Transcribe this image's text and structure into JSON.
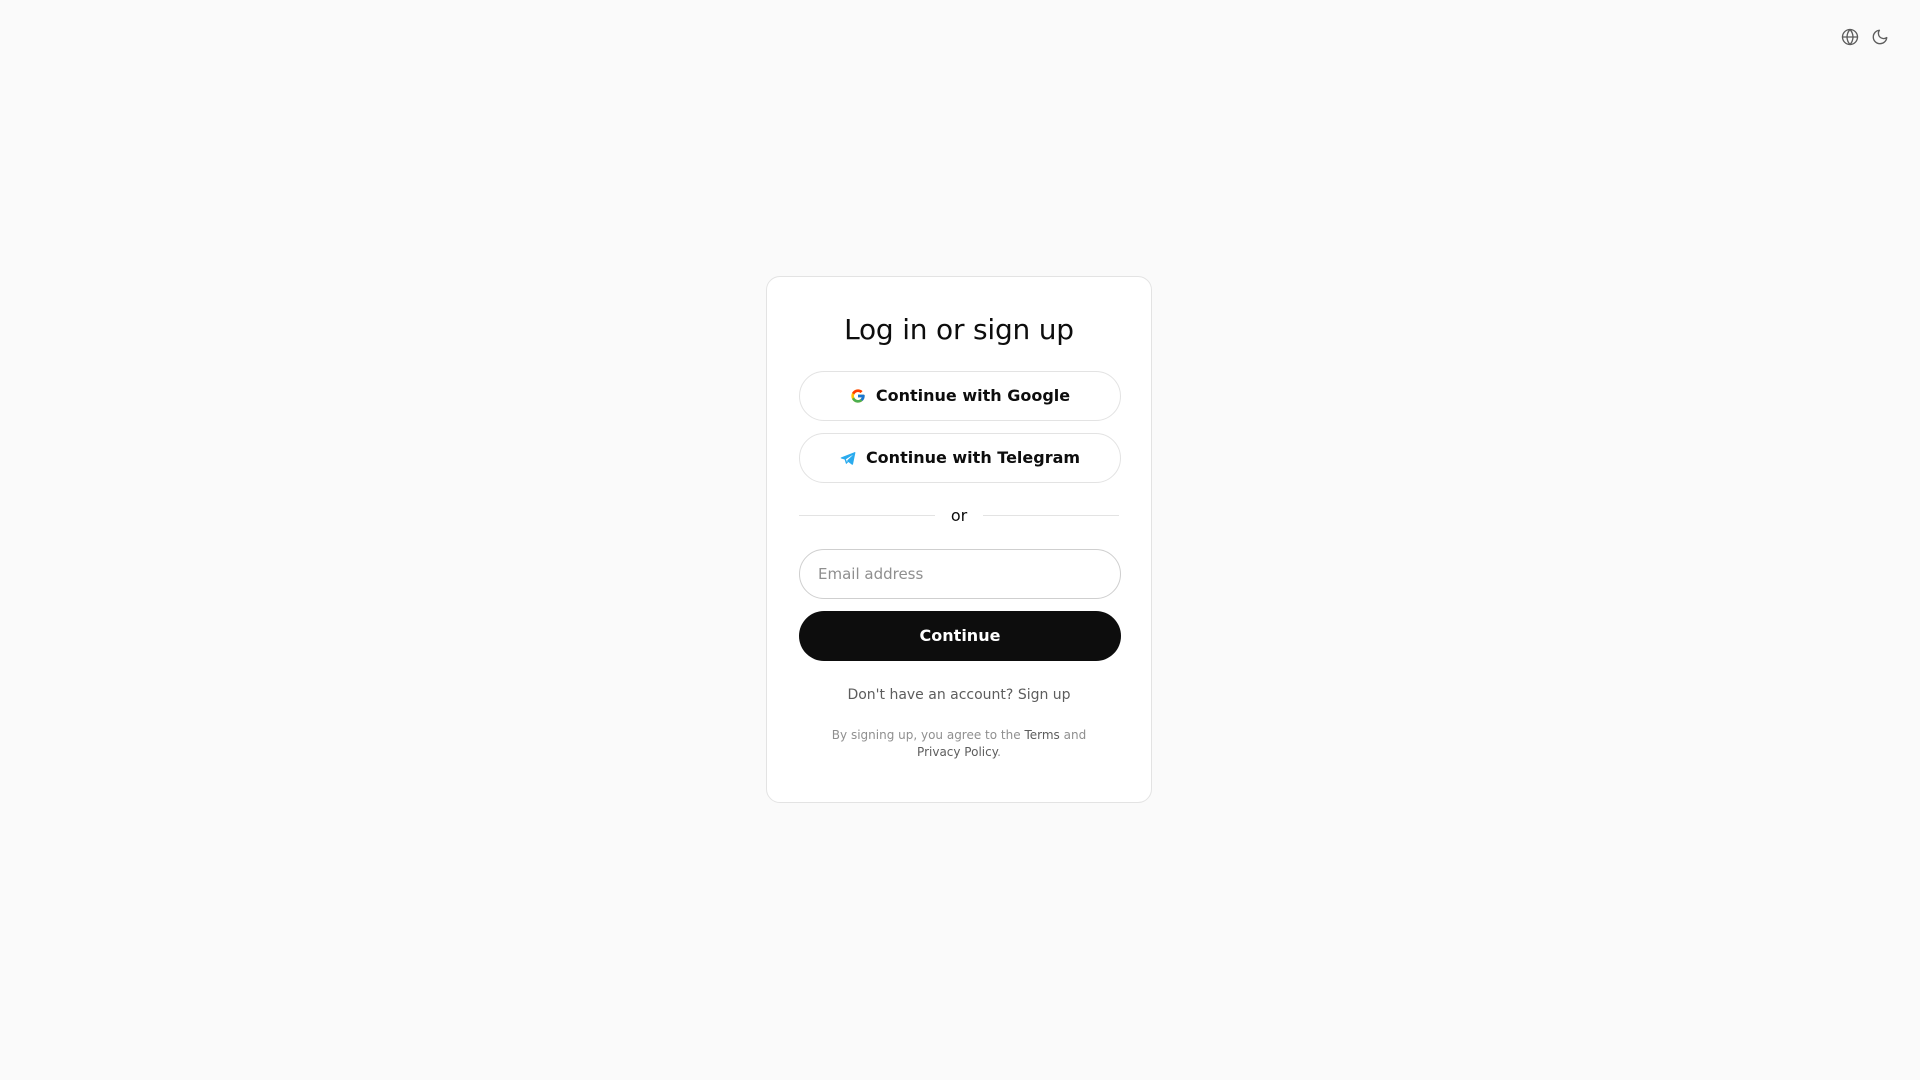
{
  "header": {
    "language_icon": "globe-icon",
    "theme_icon": "moon-icon"
  },
  "auth": {
    "title": "Log in or sign up",
    "google_label": "Continue with Google",
    "telegram_label": "Continue with Telegram",
    "divider_text": "or",
    "email_placeholder": "Email address",
    "email_value": "",
    "continue_label": "Continue",
    "no_account_text": "Don't have an account?",
    "signup_link": "Sign up",
    "legal_prefix": "By signing up, you agree to the",
    "terms_link": "Terms",
    "legal_and": "and",
    "privacy_link": "Privacy Policy",
    "legal_suffix": "."
  },
  "colors": {
    "background": "#fafafa",
    "card": "#ffffff",
    "primary_button": "#0d0d0d",
    "telegram": "#2aabee"
  }
}
